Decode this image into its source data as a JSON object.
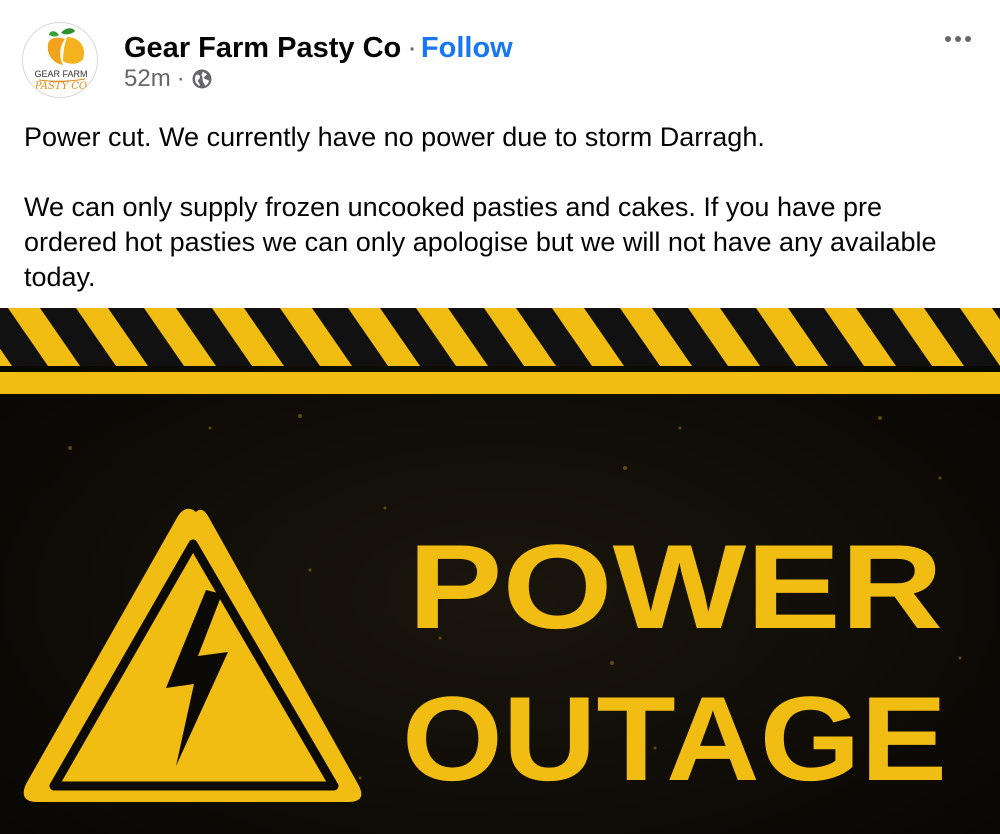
{
  "post": {
    "page_name": "Gear Farm Pasty Co",
    "separator": "·",
    "follow_label": "Follow",
    "time": "52m",
    "meta_separator": "·",
    "audience_icon": "globe-icon",
    "more_icon": "more-horizontal-icon",
    "avatar": {
      "logo_line1": "GEAR FARM",
      "logo_line2": "PASTY CO"
    },
    "text_paragraphs": [
      "Power cut. We currently have no power due to storm Darragh.",
      "We can only supply frozen uncooked pasties and cakes. If you have pre ordered hot pasties we can only apologise but we will not have any available today."
    ]
  },
  "image": {
    "line1": "POWER",
    "line2": "OUTAGE",
    "warning_icon": "high-voltage-warning-icon",
    "colors": {
      "yellow": "#f2bd12",
      "black": "#0c0a07"
    }
  },
  "colors": {
    "link": "#1877f2",
    "secondary_text": "#65676b",
    "primary_text": "#050505"
  }
}
